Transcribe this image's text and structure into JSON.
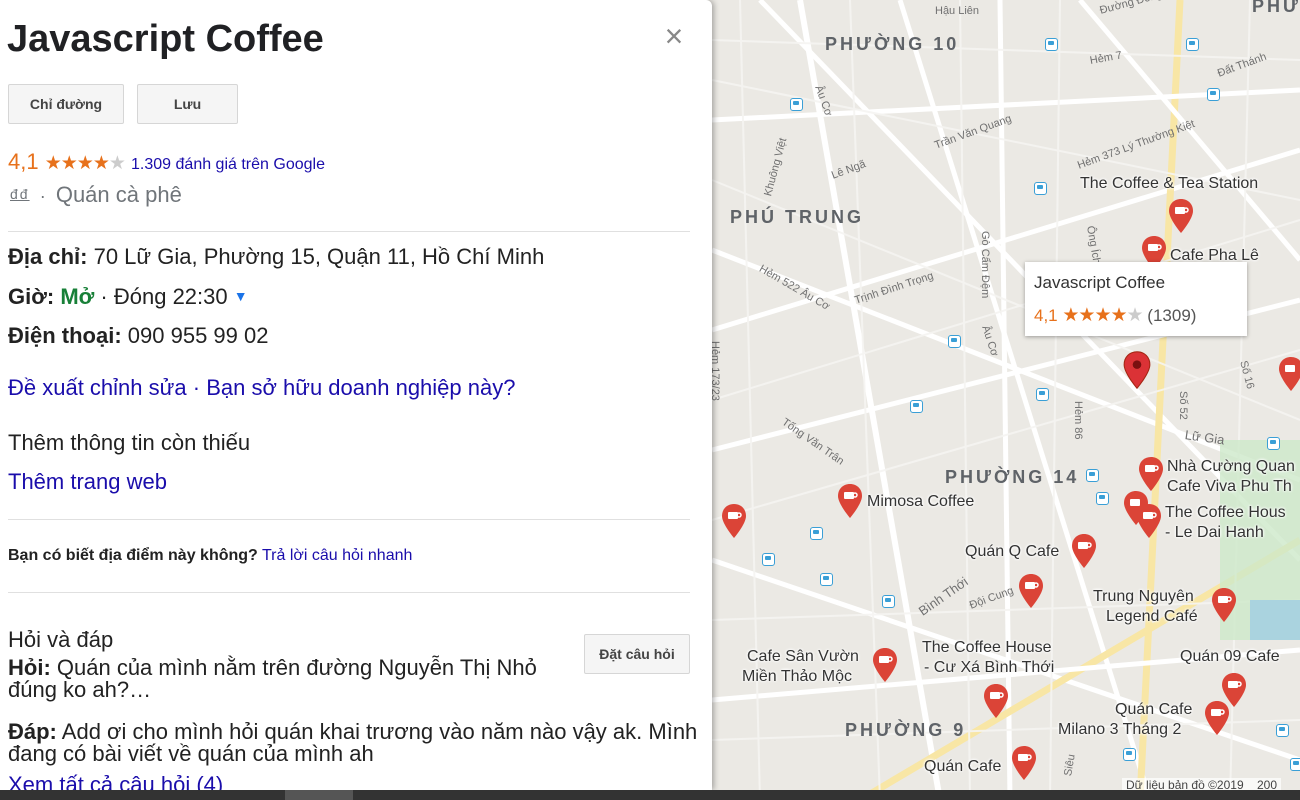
{
  "place": {
    "title": "Javascript Coffee",
    "close_symbol": "×",
    "buttons": {
      "directions": "Chỉ đường",
      "save": "Lưu"
    },
    "rating_value": "4,1",
    "rating_stars_filled": 4,
    "rating_stars_total": 5,
    "review_link": "1.309 đánh giá trên Google",
    "price": "đđ",
    "separator": "·",
    "category": "Quán cà phê",
    "address_label": "Địa chỉ:",
    "address": "70 Lữ Gia, Phường 15, Quận 11, Hồ Chí Minh",
    "hours_label": "Giờ:",
    "hours_status": "Mở",
    "hours_close": "· Đóng 22:30",
    "phone_label": "Điện thoại:",
    "phone": "090 955 99 02",
    "suggest_edit": "Đề xuất chỉnh sửa",
    "own_business": "Bạn sở hữu doanh nghiệp này?",
    "add_missing": "Thêm thông tin còn thiếu",
    "add_website": "Thêm trang web",
    "know_place_q": "Bạn có biết địa điểm này không?",
    "quick_answer": "Trả lời câu hỏi nhanh",
    "qa_title": "Hỏi và đáp",
    "ask_button": "Đặt câu hỏi",
    "question_label": "Hỏi:",
    "question_text": "Quán của mình nằm trên đường Nguyễn Thị Nhỏ đúng ko ah?…",
    "answer_label": "Đáp:",
    "answer_text": "Add ơi cho mình hỏi quán khai trương vào năm nào vậy ak. Mình đang có bài viết về quán của mình ah",
    "see_all_questions": "Xem tất cả câu hỏi (4)"
  },
  "map": {
    "tooltip": {
      "name": "Javascript Coffee",
      "rating": "4,1",
      "count": "(1309)"
    },
    "areas": [
      "PHƯỜNG 10",
      "PHÚ TRUNG",
      "PHƯỜNG 14",
      "PHƯỜNG 9"
    ],
    "streets": [
      "Âu Cơ",
      "Âu Cơ",
      "Trần Văn Quang",
      "Lê Ngã",
      "Khuông Việt",
      "Hẻm 522 Âu Cơ",
      "Trịnh Đình Trọng",
      "Gò Cẩm Đệm",
      "Ông Ích",
      "Hẻm 373 Lý Thường Kiệt",
      "Tống Văn Trân",
      "Hẻm 86",
      "Lữ Gia",
      "Số 52",
      "Số 16",
      "Bình Thới",
      "Đội Cung",
      "Hẻm 173/23",
      "Hẻm 7",
      "Đất Thánh",
      "Đường Đông Hồ",
      "Hậu Liên",
      "Siêu",
      "PHƯ"
    ],
    "pois": [
      "The Coffee & Tea Station",
      "Cafe Pha Lê",
      "Nhà Cường Quan",
      "Cafe Viva Phu Th",
      "The Coffee Hous",
      "- Le Dai Hanh",
      "Mimosa Coffee",
      "Quán Q Cafe",
      "Trung Nguyên",
      "Legend Café",
      "Cafe Sân Vườn",
      "Miền Thảo Mộc",
      "The Coffee House",
      "- Cư Xá Bình Thới",
      "Quán 09 Cafe",
      "Quán Cafe",
      "Milano 3 Tháng 2",
      "Quán Cafe"
    ],
    "attribution": "Dữ liệu bản đồ ©2019",
    "attribution_tail": "200"
  },
  "colors": {
    "link": "#1a0dab",
    "star": "#e7711b",
    "open": "#188038",
    "pin": "#db4437",
    "transit": "#3a9fd6"
  }
}
